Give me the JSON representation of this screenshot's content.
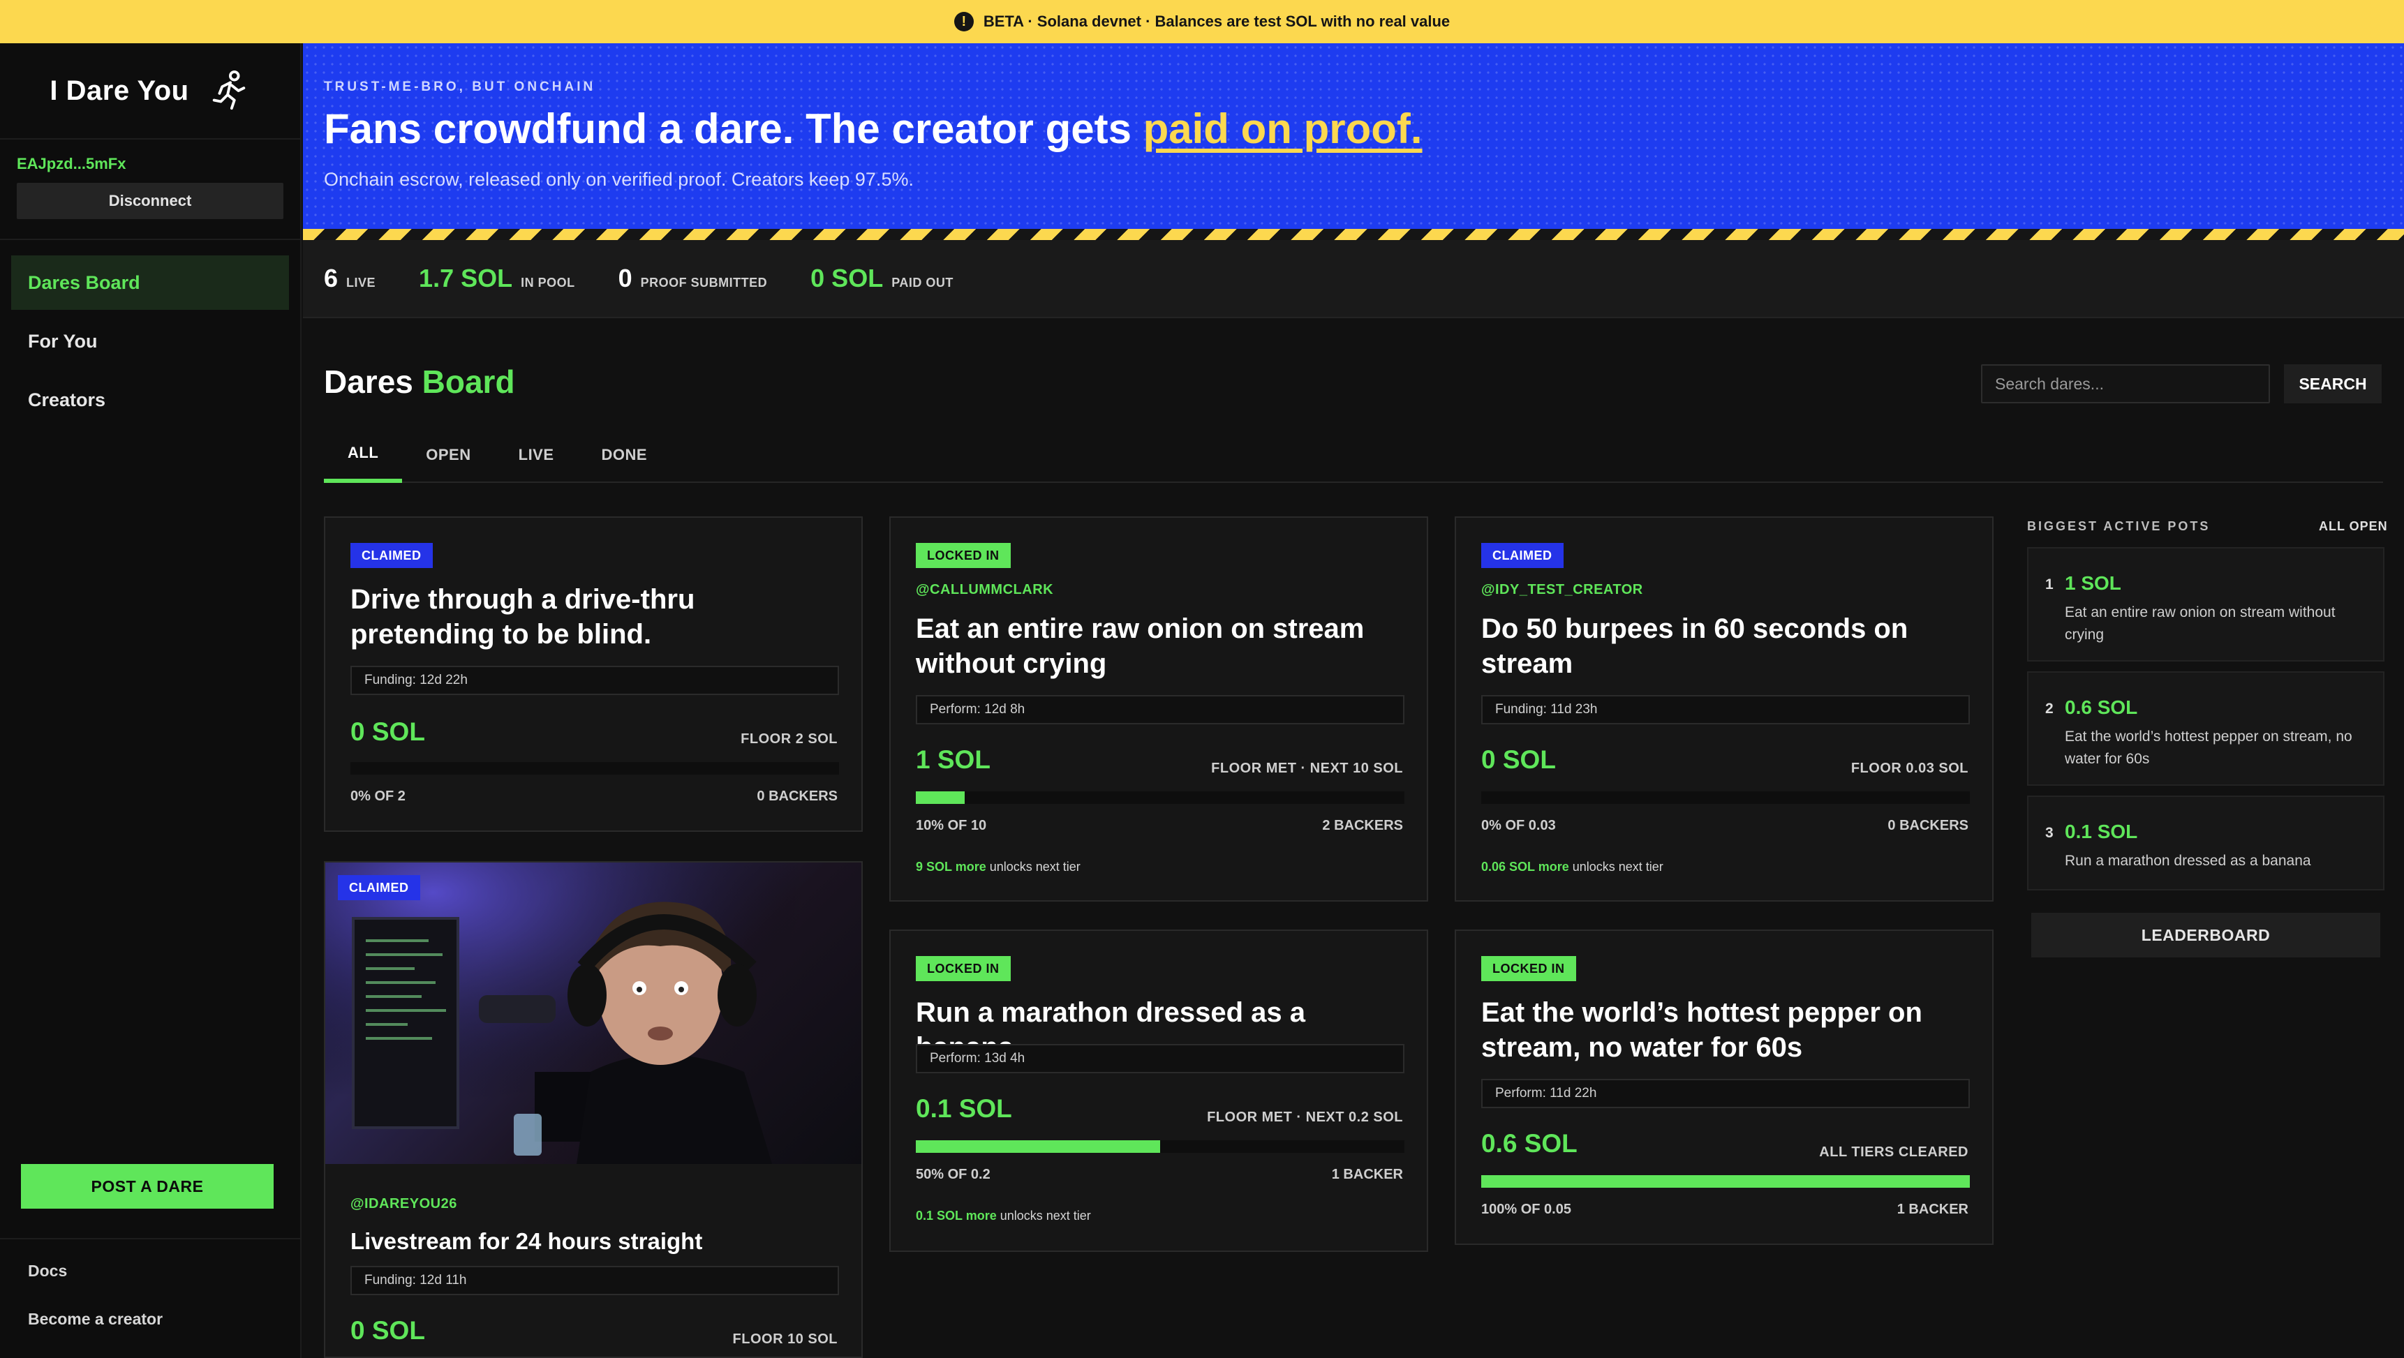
{
  "beta_banner": {
    "icon": "exclamation-icon",
    "text": "BETA · Solana devnet · Balances are test SOL with no real value"
  },
  "sidebar": {
    "brand": "I Dare You",
    "brand_icon": "running-person-icon",
    "wallet": "EAJpzd...5mFx",
    "disconnect": "Disconnect",
    "nav": [
      "Dares Board",
      "For You",
      "Creators"
    ],
    "post_button": "POST A DARE",
    "footer": [
      "Docs",
      "Become a creator"
    ]
  },
  "hero": {
    "eyebrow": "TRUST-ME-BRO, BUT ONCHAIN",
    "title_start": "Fans crowdfund a dare. The creator gets ",
    "title_link": "paid on proof.",
    "subtitle": "Onchain escrow, released only on verified proof. Creators keep 97.5%."
  },
  "stats": [
    {
      "value": "6",
      "label": "LIVE",
      "green": false
    },
    {
      "value": "1.7 SOL",
      "label": "IN POOL",
      "green": true
    },
    {
      "value": "0",
      "label": "PROOF SUBMITTED",
      "green": false
    },
    {
      "value": "0 SOL",
      "label": "PAID OUT",
      "green": true
    }
  ],
  "board": {
    "title_a": "Dares",
    "title_b": "Board",
    "search_placeholder": "Search dares...",
    "search_button": "SEARCH",
    "tabs": [
      "ALL",
      "OPEN",
      "LIVE",
      "DONE"
    ]
  },
  "cards": [
    {
      "badge": "CLAIMED",
      "handle": "",
      "title": "Drive through a drive-thru pretending to be blind.",
      "timer": "Funding: 12d 22h",
      "amount": "0 SOL",
      "floor": "FLOOR 2 SOL",
      "progress": 0,
      "pct": "0% OF 2",
      "backers": "0 BACKERS",
      "unlock_amount": "",
      "unlock_text": ""
    },
    {
      "badge": "LOCKED IN",
      "handle": "@CALLUMMCLARK",
      "title": "Eat an entire raw onion on stream without crying",
      "timer": "Perform: 12d 8h",
      "amount": "1 SOL",
      "floor": "FLOOR MET · NEXT 10 SOL",
      "progress": 0.1,
      "pct": "10% OF 10",
      "backers": "2 BACKERS",
      "unlock_amount": "9 SOL more",
      "unlock_text": " unlocks next tier"
    },
    {
      "badge": "CLAIMED",
      "handle": "@IDY_TEST_CREATOR",
      "title": "Do 50 burpees in 60 seconds on stream",
      "timer": "Funding: 11d 23h",
      "amount": "0 SOL",
      "floor": "FLOOR 0.03 SOL",
      "progress": 0,
      "pct": "0% OF 0.03",
      "backers": "0 BACKERS",
      "unlock_amount": "0.06 SOL more",
      "unlock_text": " unlocks next tier"
    },
    {
      "badge": "CLAIMED",
      "handle": "@IDAREYOU26",
      "title": "Livestream for 24 hours straight",
      "timer": "Funding: 12d 11h",
      "amount": "0 SOL",
      "floor": "FLOOR 10 SOL",
      "progress": 0,
      "pct": "",
      "backers": "",
      "unlock_amount": "",
      "unlock_text": ""
    },
    {
      "badge": "LOCKED IN",
      "handle": "",
      "title": "Run a marathon dressed as a banana",
      "timer": "Perform: 13d 4h",
      "amount": "0.1 SOL",
      "floor": "FLOOR MET · NEXT 0.2 SOL",
      "progress": 0.5,
      "pct": "50% OF 0.2",
      "backers": "1 BACKER",
      "unlock_amount": "0.1 SOL more",
      "unlock_text": " unlocks next tier"
    },
    {
      "badge": "LOCKED IN",
      "handle": "",
      "title": "Eat the world’s hottest pepper on stream, no water for 60s",
      "timer": "Perform: 11d 22h",
      "amount": "0.6 SOL",
      "floor": "ALL TIERS CLEARED",
      "progress": 1,
      "pct": "100% OF 0.05",
      "backers": "1 BACKER",
      "unlock_amount": "",
      "unlock_text": ""
    }
  ],
  "right_panel": {
    "heading": "BIGGEST ACTIVE POTS",
    "all_open": "ALL OPEN",
    "pots": [
      {
        "rank": "1",
        "amount": "1 SOL",
        "desc": "Eat an entire raw onion on stream without crying"
      },
      {
        "rank": "2",
        "amount": "0.6 SOL",
        "desc": "Eat the world’s hottest pepper on stream, no water for 60s"
      },
      {
        "rank": "3",
        "amount": "0.1 SOL",
        "desc": "Run a marathon dressed as a banana"
      }
    ],
    "leaderboard": "LEADERBOARD"
  },
  "colors": {
    "accent_green": "#5fe65a",
    "beta_yellow": "#fcd84f",
    "hero_blue": "#1e3cf0",
    "claimed_blue": "#2533e8"
  }
}
